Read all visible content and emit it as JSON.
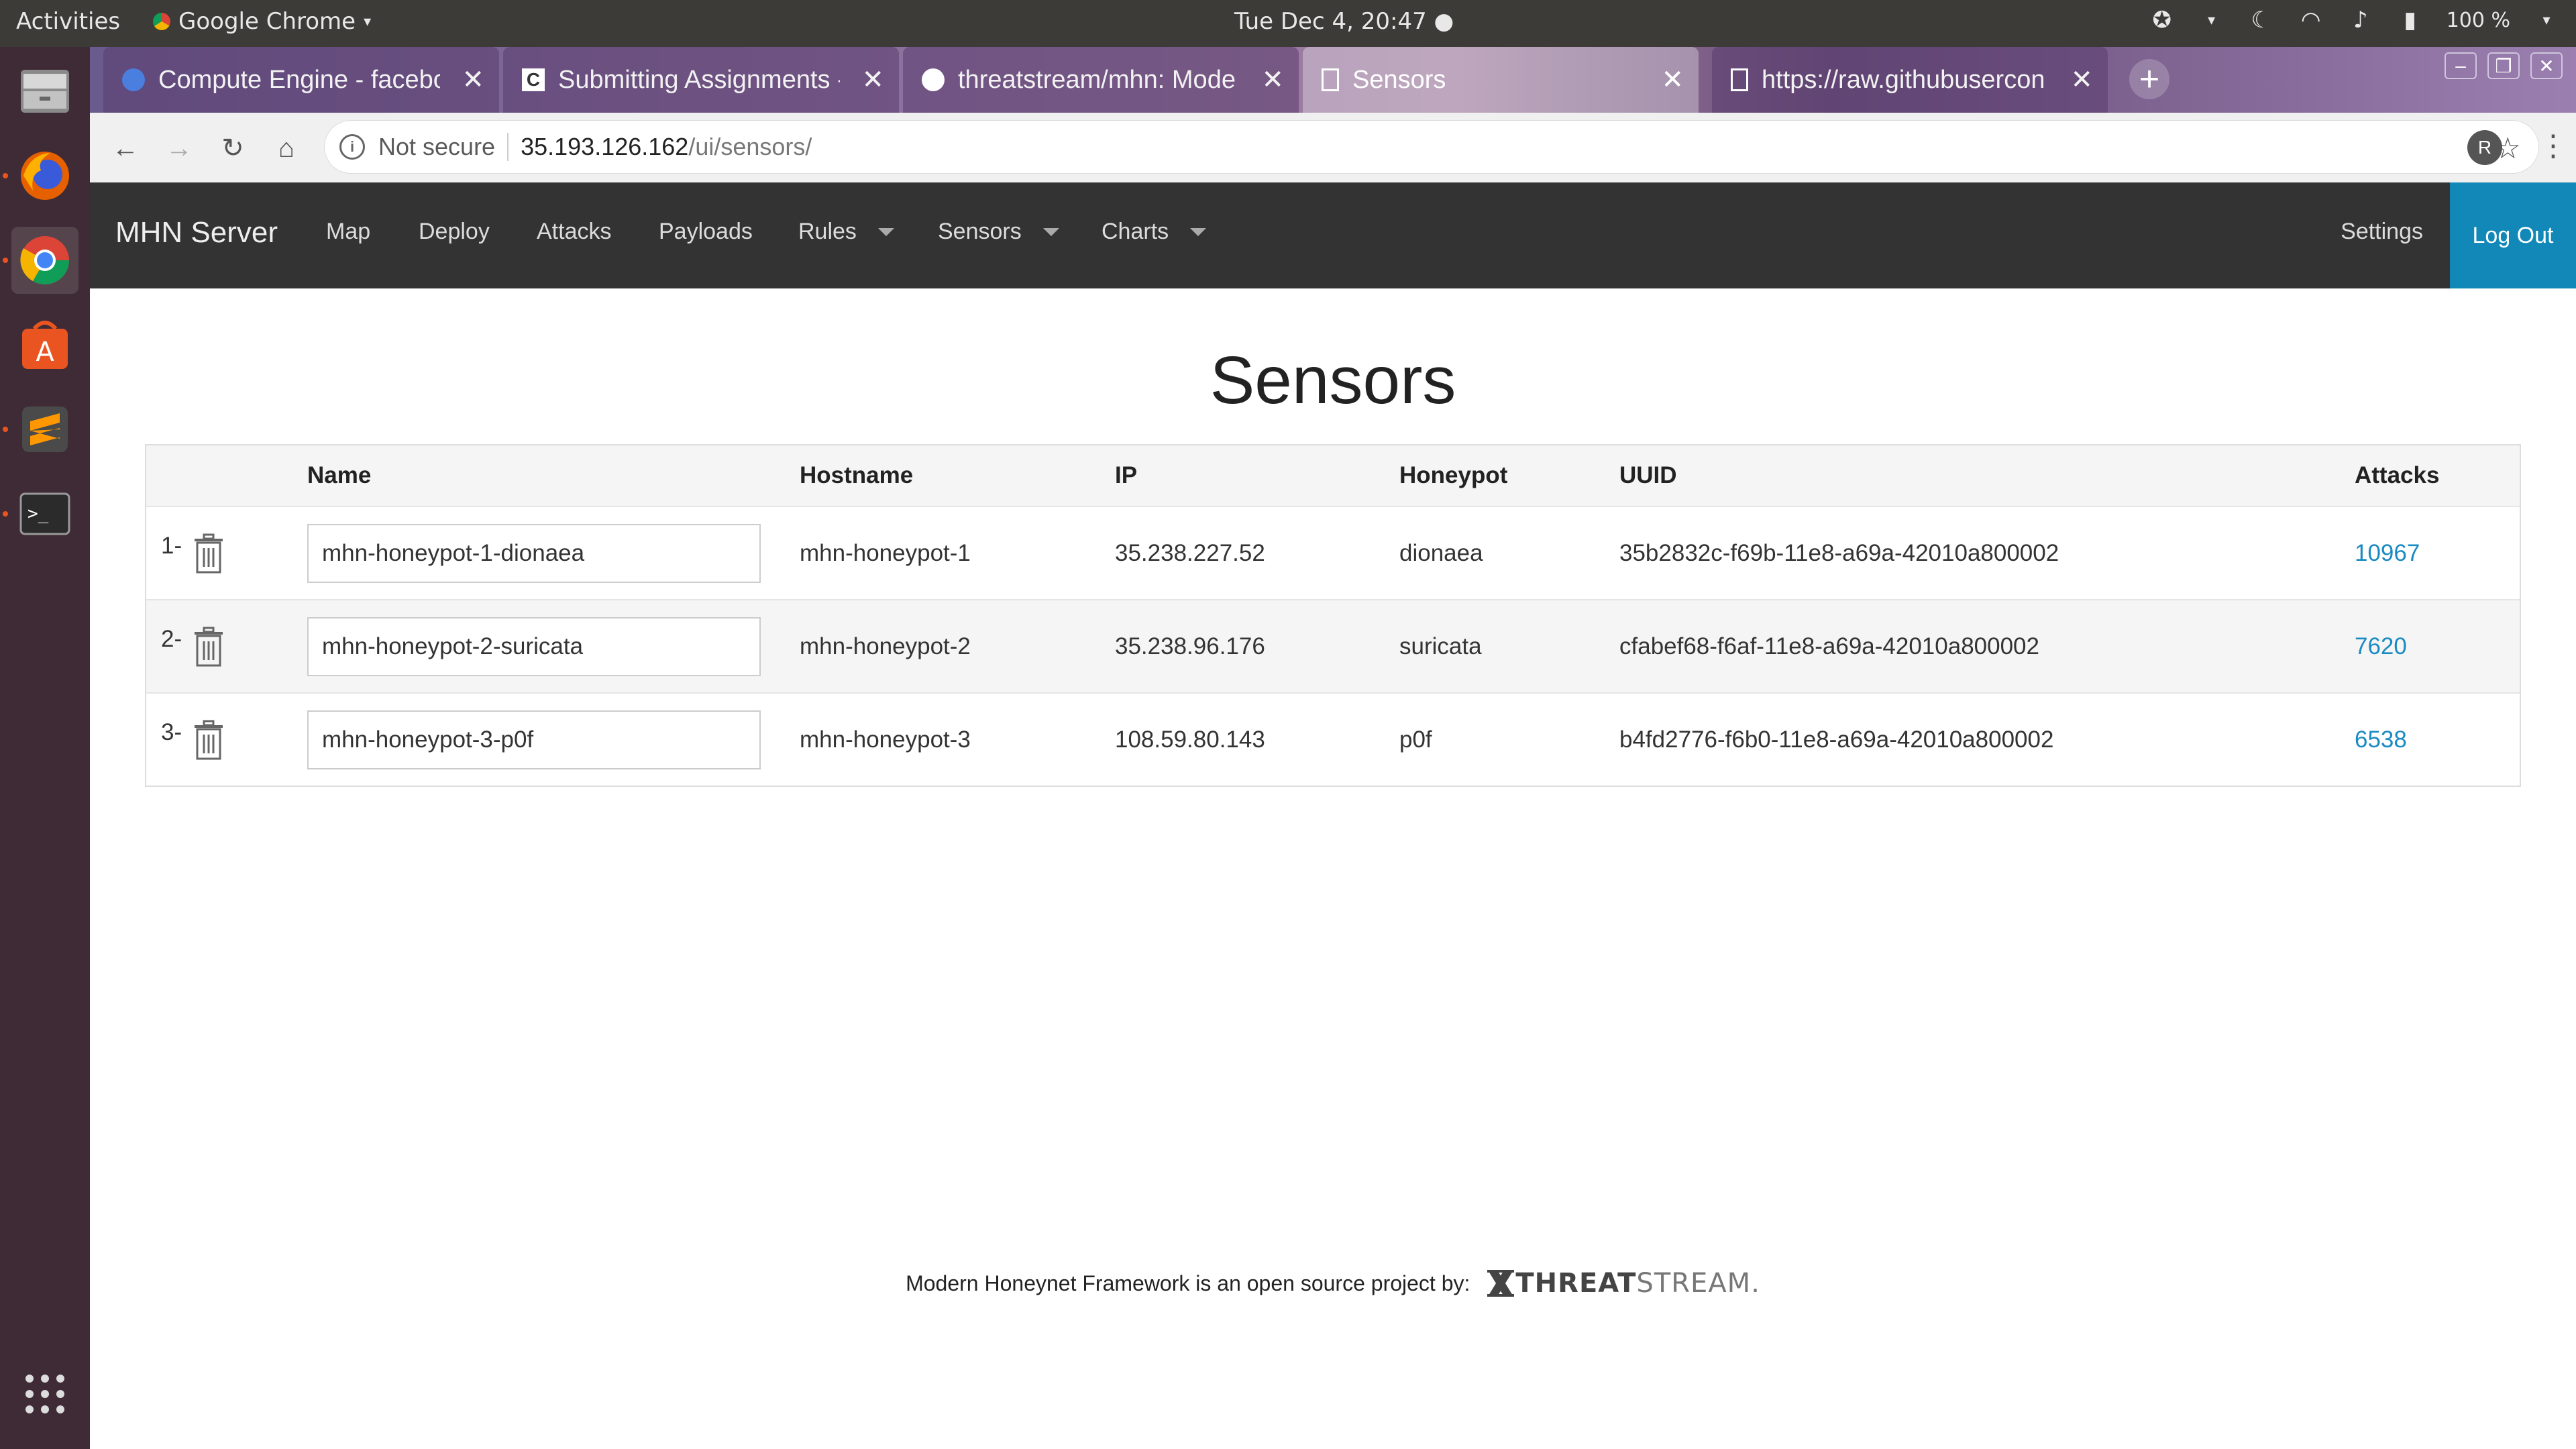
{
  "system": {
    "activities": "Activities",
    "app_name": "Google Chrome",
    "clock": "Tue Dec  4, 20:47",
    "battery": "100 %"
  },
  "tabs": [
    {
      "title": "Compute Engine - facebo",
      "active": false
    },
    {
      "title": "Submitting Assignments -",
      "active": false
    },
    {
      "title": "threatstream/mhn: Mode",
      "active": false
    },
    {
      "title": "Sensors",
      "active": true
    },
    {
      "title": "https://raw.githubusercon",
      "active": false
    }
  ],
  "omnibox": {
    "security": "Not secure",
    "host": "35.193.126.162",
    "path": "/ui/sensors/"
  },
  "profile_initial": "R",
  "navbar": {
    "brand": "MHN Server",
    "links": [
      "Map",
      "Deploy",
      "Attacks",
      "Payloads",
      "Rules",
      "Sensors",
      "Charts"
    ],
    "settings": "Settings",
    "logout": "Log Out"
  },
  "page_title": "Sensors",
  "table": {
    "headers": {
      "name": "Name",
      "hostname": "Hostname",
      "ip": "IP",
      "honeypot": "Honeypot",
      "uuid": "UUID",
      "attacks": "Attacks"
    },
    "rows": [
      {
        "num": "1-",
        "name": "mhn-honeypot-1-dionaea",
        "hostname": "mhn-honeypot-1",
        "ip": "35.238.227.52",
        "honeypot": "dionaea",
        "uuid": "35b2832c-f69b-11e8-a69a-42010a800002",
        "attacks": "10967"
      },
      {
        "num": "2-",
        "name": "mhn-honeypot-2-suricata",
        "hostname": "mhn-honeypot-2",
        "ip": "35.238.96.176",
        "honeypot": "suricata",
        "uuid": "cfabef68-f6af-11e8-a69a-42010a800002",
        "attacks": "7620"
      },
      {
        "num": "3-",
        "name": "mhn-honeypot-3-p0f",
        "hostname": "mhn-honeypot-3",
        "ip": "108.59.80.143",
        "honeypot": "p0f",
        "uuid": "b4fd2776-f6b0-11e8-a69a-42010a800002",
        "attacks": "6538"
      }
    ]
  },
  "footer": {
    "text": "Modern Honeynet Framework is an open source project by:",
    "logo_bold": "THREAT",
    "logo_thin": "STREAM."
  },
  "colors": {
    "accent": "#1188b8",
    "navbar": "#333333",
    "link": "#1a8ac2"
  }
}
